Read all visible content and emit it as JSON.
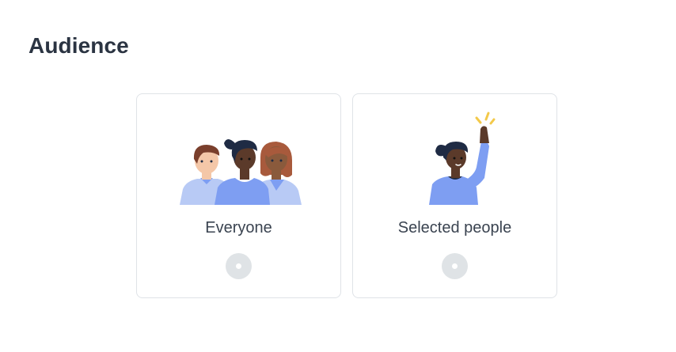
{
  "page": {
    "title": "Audience"
  },
  "options": [
    {
      "label": "Everyone",
      "icon": "group-of-people-illustration",
      "selected": false
    },
    {
      "label": "Selected people",
      "icon": "person-raising-hand-illustration",
      "selected": false
    }
  ],
  "colors": {
    "title": "#2b3442",
    "card_border": "#dfe3e7",
    "radio_fill": "#dfe3e6",
    "shirt_blue": "#7e9ef2",
    "shirt_light": "#b8caf5",
    "hair_dark": "#1f2b44",
    "hair_brown": "#7a3f2c",
    "sparkle_yellow": "#f3c94a"
  }
}
